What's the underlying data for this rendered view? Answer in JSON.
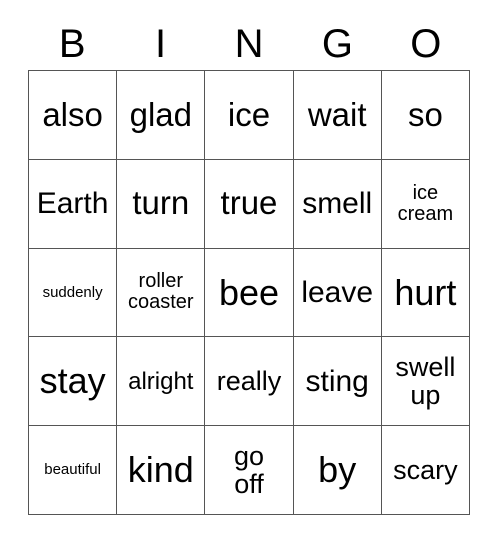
{
  "card": {
    "title_letters": [
      "B",
      "I",
      "N",
      "G",
      "O"
    ],
    "colors": {
      "background": "#ffffff",
      "text": "#000000",
      "grid_line": "#555555"
    },
    "rows": [
      [
        {
          "text": "also",
          "size": "fs-2xl"
        },
        {
          "text": "glad",
          "size": "fs-2xl"
        },
        {
          "text": "ice",
          "size": "fs-2xl"
        },
        {
          "text": "wait",
          "size": "fs-2xl"
        },
        {
          "text": "so",
          "size": "fs-2xl"
        }
      ],
      [
        {
          "text": "Earth",
          "size": "fs-xl"
        },
        {
          "text": "turn",
          "size": "fs-2xl"
        },
        {
          "text": "true",
          "size": "fs-2xl"
        },
        {
          "text": "smell",
          "size": "fs-xl"
        },
        {
          "text": "ice\ncream",
          "size": "fs-sm"
        }
      ],
      [
        {
          "text": "suddenly",
          "size": "fs-xs"
        },
        {
          "text": "roller\ncoaster",
          "size": "fs-sm"
        },
        {
          "text": "bee",
          "size": "fs-3xl"
        },
        {
          "text": "leave",
          "size": "fs-xl"
        },
        {
          "text": "hurt",
          "size": "fs-3xl"
        }
      ],
      [
        {
          "text": "stay",
          "size": "fs-3xl"
        },
        {
          "text": "alright",
          "size": "fs-md"
        },
        {
          "text": "really",
          "size": "fs-lg"
        },
        {
          "text": "sting",
          "size": "fs-xl"
        },
        {
          "text": "swell\nup",
          "size": "fs-lg"
        }
      ],
      [
        {
          "text": "beautiful",
          "size": "fs-xs"
        },
        {
          "text": "kind",
          "size": "fs-3xl"
        },
        {
          "text": "go\noff",
          "size": "fs-lg"
        },
        {
          "text": "by",
          "size": "fs-3xl"
        },
        {
          "text": "scary",
          "size": "fs-lg"
        }
      ]
    ]
  }
}
